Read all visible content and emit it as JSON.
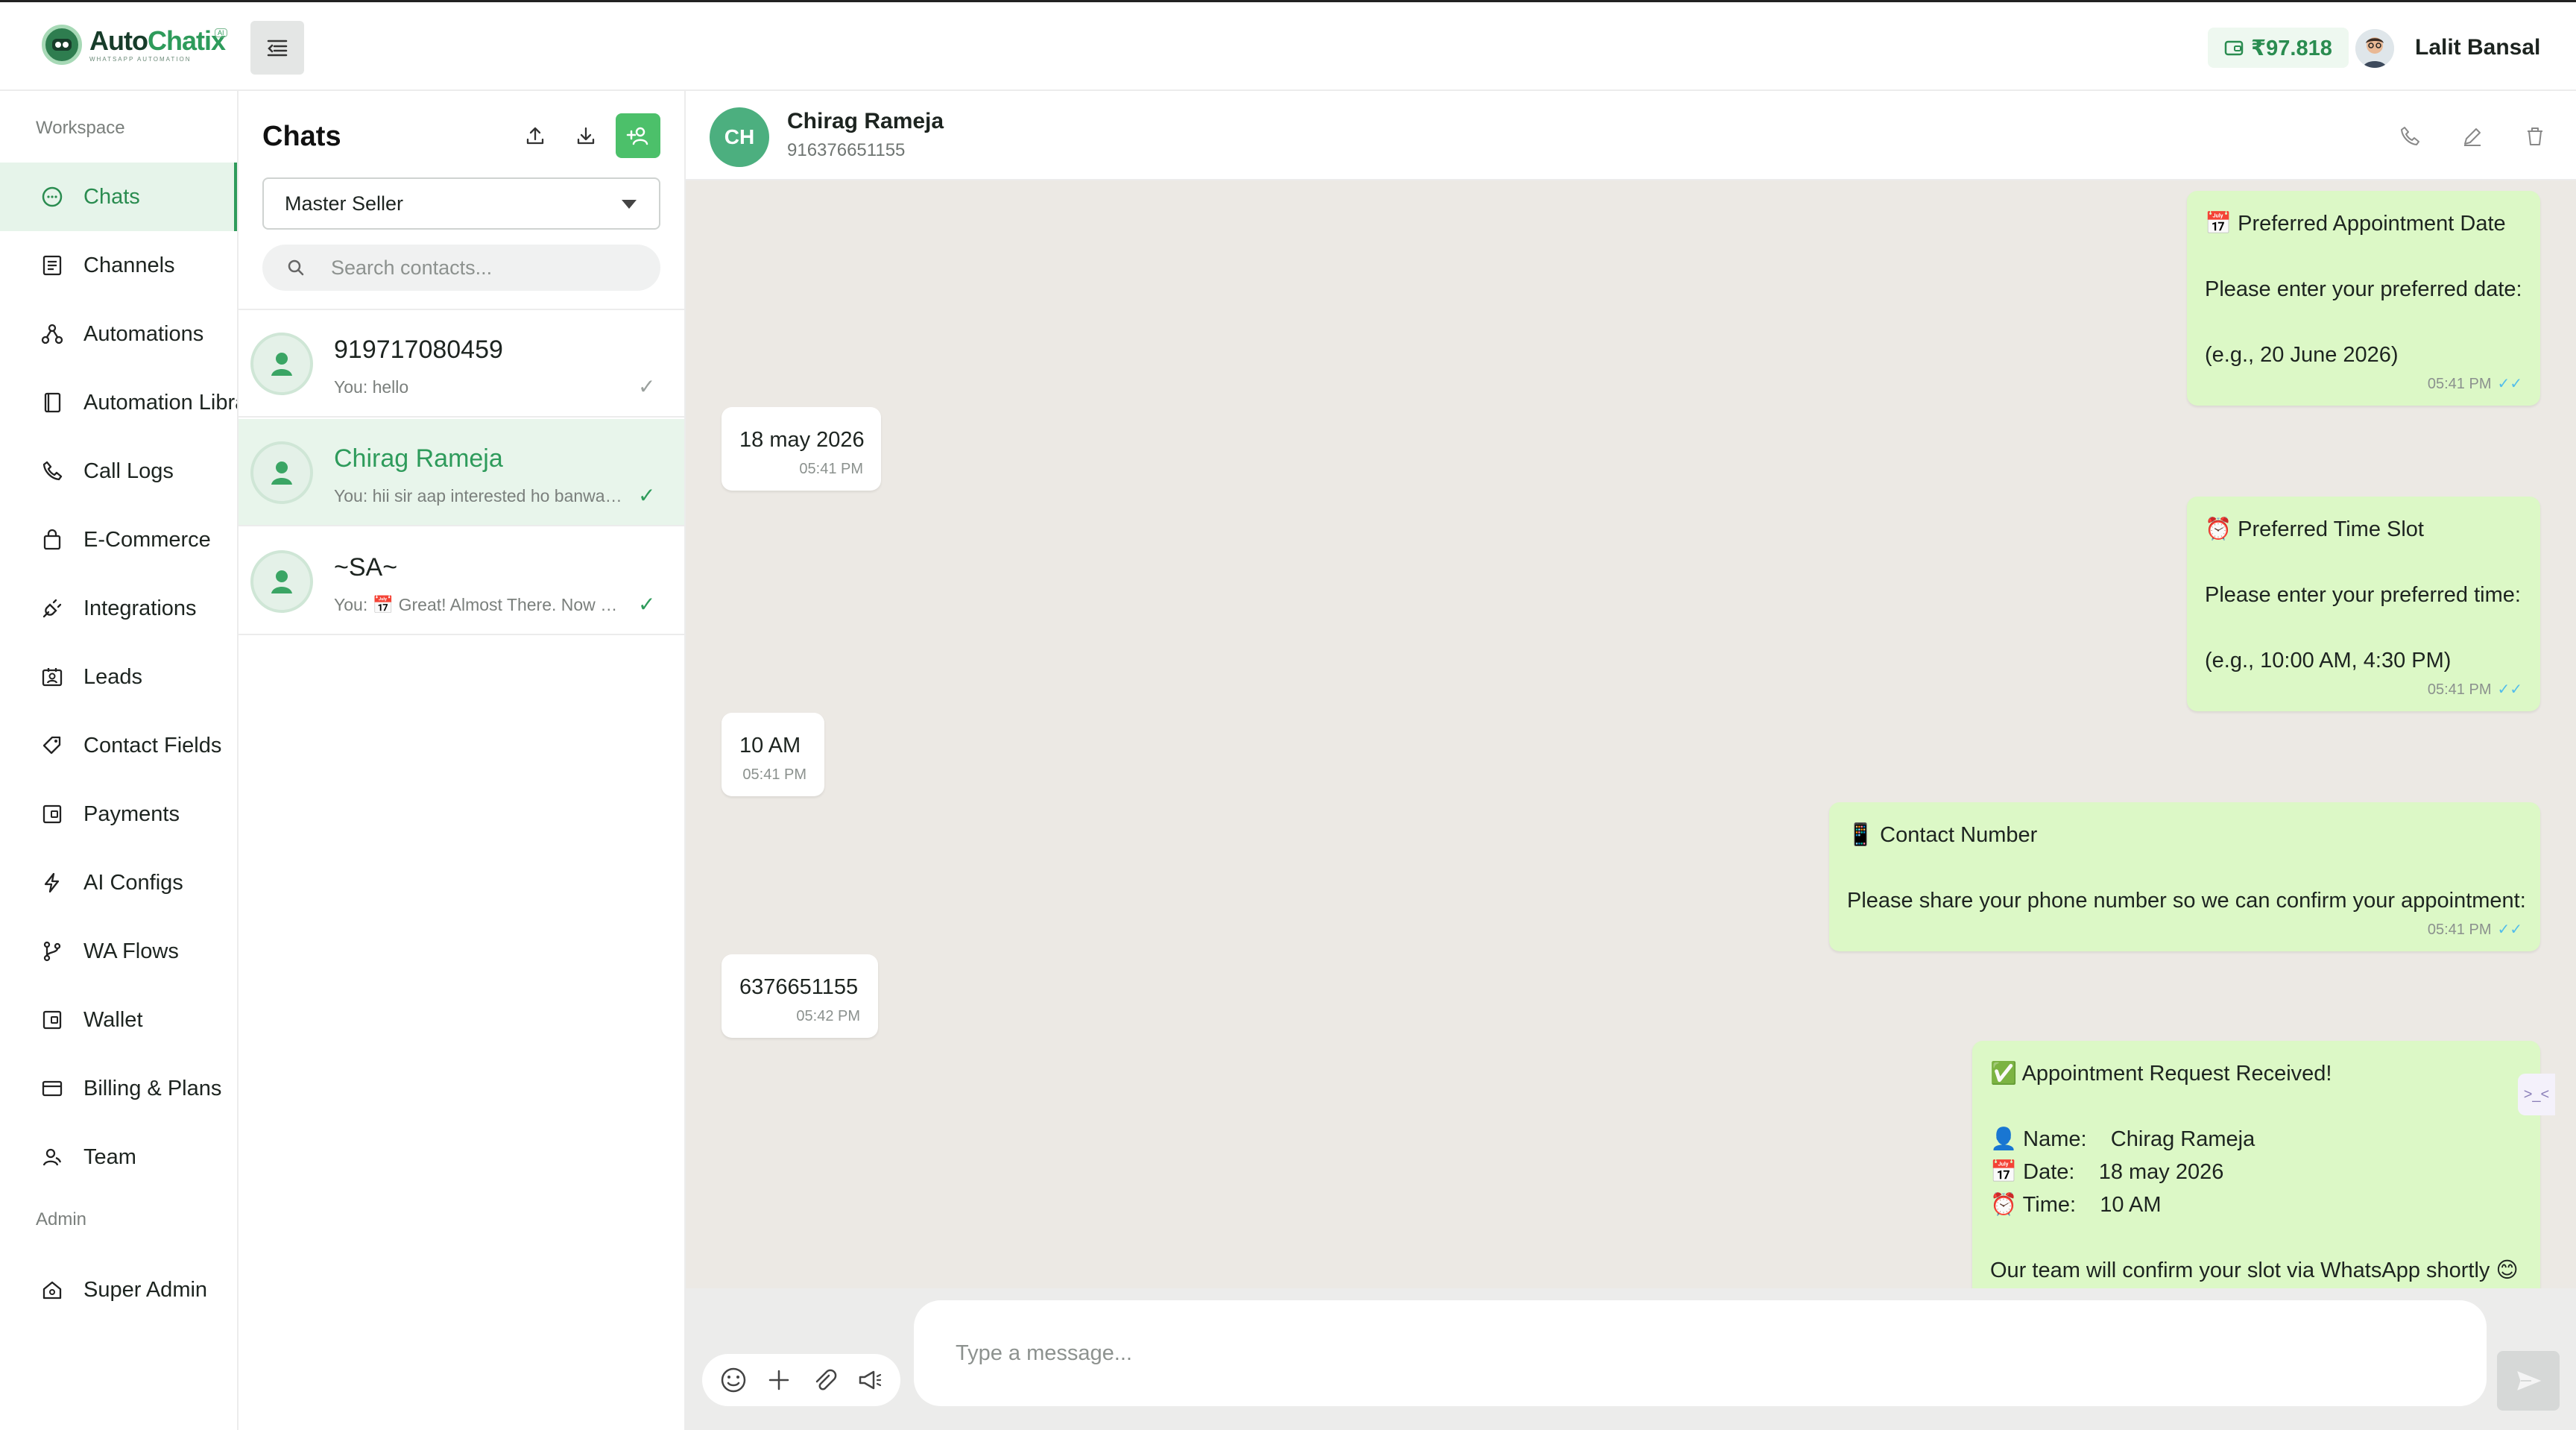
{
  "app": {
    "name_part1": "Auto",
    "name_part2": "Chatix",
    "tagline": "WHATSAPP AUTOMATION",
    "badge": "AI"
  },
  "topbar": {
    "wallet_balance": "₹97.818",
    "user_name": "Lalit Bansal"
  },
  "sidebar": {
    "workspace_label": "Workspace",
    "admin_label": "Admin",
    "items": [
      {
        "label": "Chats",
        "icon": "chat-icon",
        "active": true
      },
      {
        "label": "Channels",
        "icon": "channels-icon"
      },
      {
        "label": "Automations",
        "icon": "automations-icon"
      },
      {
        "label": "Automation Library",
        "icon": "book-icon"
      },
      {
        "label": "Call Logs",
        "icon": "phone-icon"
      },
      {
        "label": "E-Commerce",
        "icon": "shopping-bag-icon"
      },
      {
        "label": "Integrations",
        "icon": "plug-icon"
      },
      {
        "label": "Leads",
        "icon": "contact-card-icon"
      },
      {
        "label": "Contact Fields",
        "icon": "tag-icon"
      },
      {
        "label": "Payments",
        "icon": "payments-icon"
      },
      {
        "label": "AI Configs",
        "icon": "lightning-icon"
      },
      {
        "label": "WA Flows",
        "icon": "branch-icon"
      },
      {
        "label": "Wallet",
        "icon": "wallet-icon"
      },
      {
        "label": "Billing & Plans",
        "icon": "credit-card-icon"
      },
      {
        "label": "Team",
        "icon": "team-icon"
      }
    ],
    "admin_items": [
      {
        "label": "Super Admin",
        "icon": "shield-home-icon"
      }
    ]
  },
  "chatlist": {
    "title": "Chats",
    "filter_value": "Master Seller",
    "search_placeholder": "Search contacts...",
    "contacts": [
      {
        "name": "919717080459",
        "preview": "You: hello",
        "status": "sent"
      },
      {
        "name": "Chirag Rameja",
        "preview": "You: hii sir aap interested ho banwane ke liye?",
        "status": "delivered",
        "active": true
      },
      {
        "name": "~SA~",
        "preview": "You: 📅 Great! Almost There. Now please share your details",
        "status": "delivered"
      }
    ]
  },
  "conversation": {
    "initials": "CH",
    "name": "Chirag Rameja",
    "phone": "916376651155",
    "messages": [
      {
        "dir": "out",
        "lines": [
          "📅 Preferred Appointment Date",
          "",
          "Please enter your preferred date:",
          "",
          "(e.g., 20 June 2026)"
        ],
        "time": "05:41 PM",
        "ticks": "✓✓"
      },
      {
        "dir": "in",
        "lines": [
          "18 may 2026"
        ],
        "time": "05:41 PM"
      },
      {
        "dir": "out",
        "lines": [
          "⏰ Preferred Time Slot",
          "",
          "Please enter your preferred time:",
          "",
          "(e.g., 10:00 AM, 4:30 PM)"
        ],
        "time": "05:41 PM",
        "ticks": "✓✓"
      },
      {
        "dir": "in",
        "lines": [
          "10 AM"
        ],
        "time": "05:41 PM"
      },
      {
        "dir": "out",
        "lines": [
          "📱 Contact Number",
          "",
          "Please share your phone number so we can confirm your appointment:"
        ],
        "time": "05:41 PM",
        "ticks": "✓✓"
      },
      {
        "dir": "in",
        "lines": [
          "6376651155"
        ],
        "time": "05:42 PM"
      },
      {
        "dir": "out",
        "lines": [
          "✅ Appointment Request Received!",
          "",
          "👤 Name:    Chirag Rameja",
          "📅 Date:    18 may 2026",
          "⏰ Time:    10 AM",
          "",
          "Our team will confirm your slot via WhatsApp shortly 😊"
        ],
        "time": "",
        "ticks": ""
      }
    ],
    "composer_placeholder": "Type a message..."
  },
  "colors": {
    "brand": "#2e9b5b",
    "bubble_out": "#dcf8c6",
    "bubble_in": "#ffffff",
    "chat_bg": "#ece9e4",
    "read_ticks": "#53bdeb"
  }
}
